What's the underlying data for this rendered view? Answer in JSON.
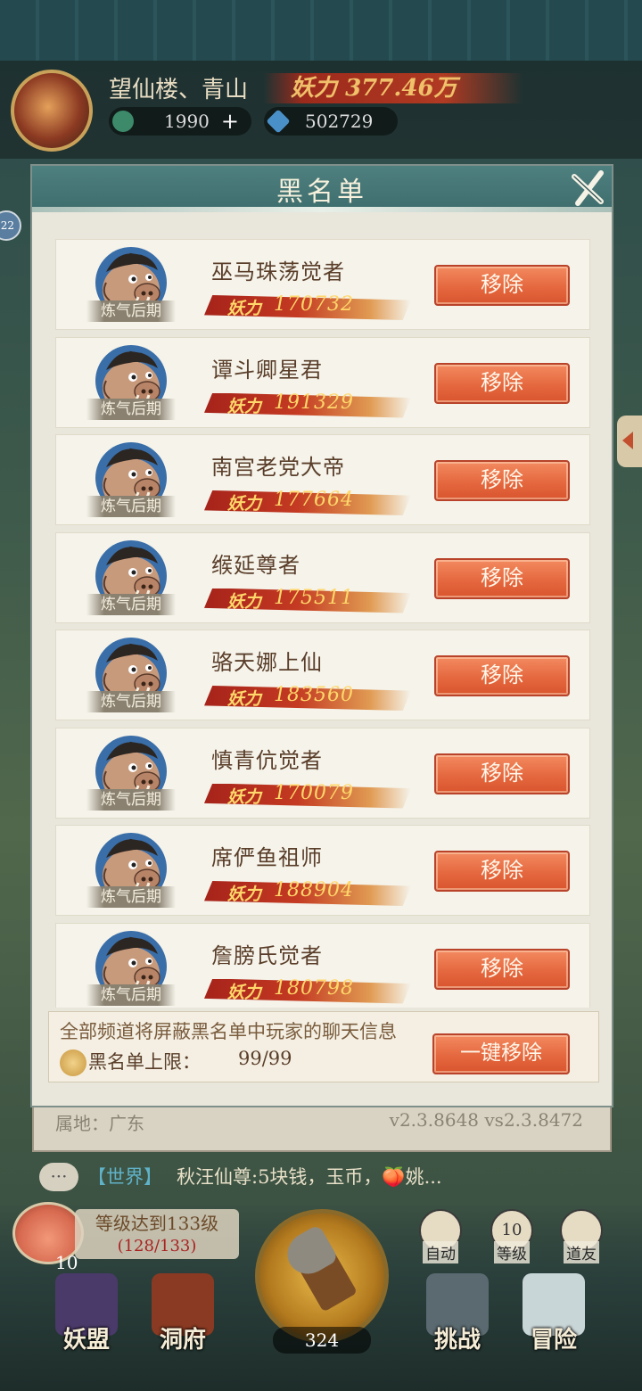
{
  "hud": {
    "location": "望仙楼、青山",
    "power_label": "妖力",
    "power_value": "377.46万",
    "coins": "1990",
    "gems": "502729",
    "side_badge": "22"
  },
  "modal": {
    "title": "黑名单",
    "remove_label": "移除",
    "rank": "炼气后期",
    "power_label": "妖力",
    "entries": [
      {
        "name": "巫马珠荡觉者",
        "power": "170732"
      },
      {
        "name": "谭斗卿星君",
        "power": "191329"
      },
      {
        "name": "南宫老党大帝",
        "power": "177664"
      },
      {
        "name": "缑延尊者",
        "power": "175511"
      },
      {
        "name": "骆天娜上仙",
        "power": "183560"
      },
      {
        "name": "慎青伉觉者",
        "power": "170079"
      },
      {
        "name": "席俨鱼祖师",
        "power": "188904"
      },
      {
        "name": "詹膀氏觉者",
        "power": "180798"
      }
    ],
    "footer_note": "全部频道将屏蔽黑名单中玩家的聊天信息",
    "cap_label": "黑名单上限：",
    "cap_value": "99/99",
    "remove_all_label": "一键移除"
  },
  "under": {
    "region": "属地：广东",
    "version": "v2.3.8648 vs2.3.8472"
  },
  "chat": {
    "channel": "【世界】",
    "message": "秋汪仙尊:5块钱，玉币，🍑姚..."
  },
  "bottom": {
    "peach_count": "10",
    "level_goal": "等级达到133级",
    "level_progress": "(128/133)",
    "axe_count": "324",
    "auto_label": "自动",
    "level_num": "10",
    "level_label": "等级",
    "friends_label": "道友",
    "nav": [
      "妖盟",
      "洞府",
      "挑战",
      "冒险"
    ]
  },
  "colors": {
    "accent_button": "#e5683f",
    "header_teal": "#4e807f",
    "power_gold": "#ffd76a"
  }
}
